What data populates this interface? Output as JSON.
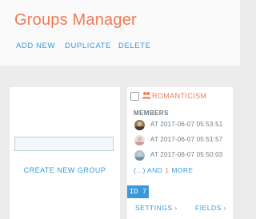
{
  "header": {
    "title": "Groups Manager"
  },
  "toolbar": {
    "add_new": "ADD NEW",
    "duplicate": "DUPLICATE",
    "delete": "DELETE"
  },
  "new_group": {
    "name_value": "",
    "create_label": "CREATE NEW GROUP"
  },
  "group": {
    "name": "ROMANTICISM",
    "members_label": "MEMBERS",
    "members": [
      {
        "time": "AT 2017-06-07 05:53:51"
      },
      {
        "time": "AT 2017-06-07 05:51:57"
      },
      {
        "time": "AT 2017-06-07 05:50:03"
      }
    ],
    "more_prefix": "(...) AND",
    "more_count": "1",
    "more_suffix": "MORE",
    "id_badge": "ID 7",
    "settings_label": "SETTINGS ›",
    "fields_label": "FIELDS ›"
  },
  "colors": {
    "accent": "#f07a52",
    "link": "#3a9ad9",
    "background": "#ececec"
  }
}
